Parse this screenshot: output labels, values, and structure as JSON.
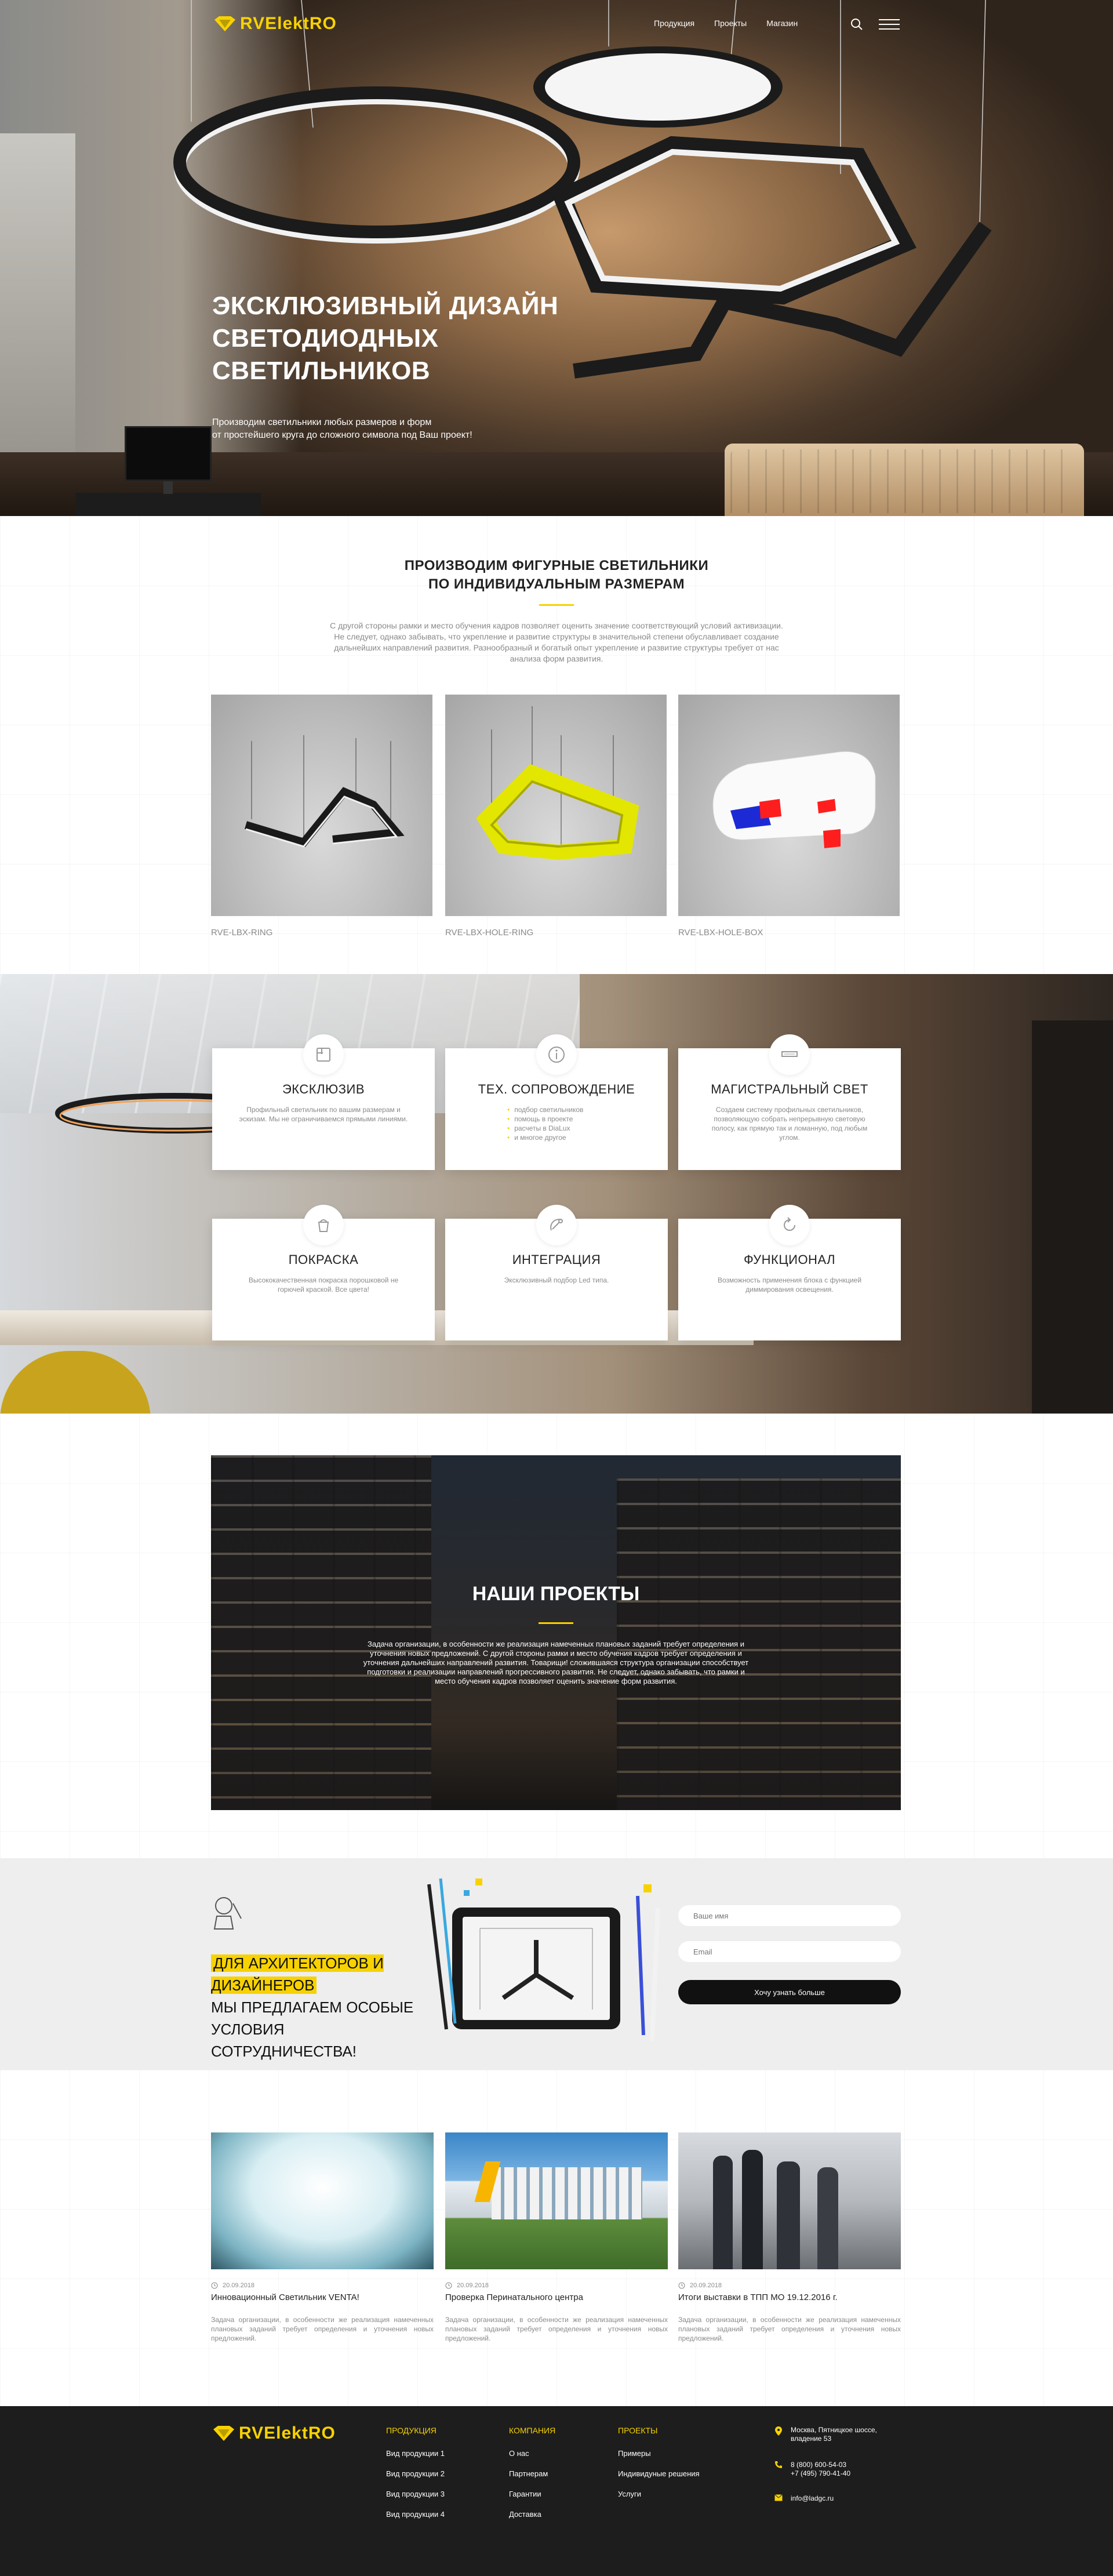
{
  "brand": {
    "logo_text": "RVElektRO",
    "color": "#f7d200"
  },
  "nav": {
    "items": [
      "Продукция",
      "Проекты",
      "Магазин"
    ]
  },
  "hero": {
    "title": "Эксклюзивный дизайн светодиодных светильников",
    "subtitle_line1": "Производим светильники любых размеров и форм",
    "subtitle_line2": "от простейшего круга до сложного символа под Ваш проект!"
  },
  "section1": {
    "title_line1": "Производим фигурные светильники",
    "title_line2": "по индивидуальным размерам",
    "lead": "С другой стороны рамки и место обучения кадров позволяет оценить значение соответствующий условий активизации. Не следует, однако забывать, что укрепление и развитие структуры в значительной степени обуславливает создание дальнейших направлений развития. Разнообразный и богатый опыт укрепление и развитие структуры требует от нас анализа форм развития.",
    "products": [
      {
        "name": "RVE-LBX-RING"
      },
      {
        "name": "RVE-LBX-HOLE-RING"
      },
      {
        "name": "RVE-LBX-HOLE-BOX"
      }
    ]
  },
  "features": [
    {
      "title": "Эксклюзив",
      "icon": "ruler-icon",
      "text": "Профильный светильник по вашим размерам и эскизам. Мы не ограничиваемся прямыми линиями."
    },
    {
      "title": "Тех. сопровождение",
      "icon": "info-icon",
      "list": [
        "подбор светильников",
        "помощь в проекте",
        "расчеты в DiaLux",
        "и многое другое"
      ]
    },
    {
      "title": "Магистральный свет",
      "icon": "track-icon",
      "text": "Создаем систему профильных светильников, позволяющую собрать непрерывную световую полосу, как прямую так и ломанную, под любым углом."
    },
    {
      "title": "Покраска",
      "icon": "paint-bucket-icon",
      "text": "Высококачественная покраска порошковой не горючей краской. Все цвета!"
    },
    {
      "title": "Интеграция",
      "icon": "satellite-icon",
      "text": "Эксклюзивный подбор Led типа."
    },
    {
      "title": "Функционал",
      "icon": "refresh-icon",
      "text": "Возможность применения блока с функцией диммирования освещения."
    }
  ],
  "projects": {
    "title": "Наши проекты",
    "text": "Задача организации, в особенности же реализация намеченных плановых заданий требует определения и уточнения новых предложений. С другой стороны рамки и место обучения кадров требует определения и уточнения дальнейших направлений развития. Товарищи! сложившаяся структура организации способствует подготовки и реализации направлений прогрессивного развития. Не следует, однако забывать, что рамки и место обучения кадров позволяет оценить значение форм развития."
  },
  "cta": {
    "title_highlight": "Для архитекторов и дизайнеров",
    "title_rest_1": "мы предлагаем особые условия",
    "title_rest_2": "сотрудничества!",
    "name_placeholder": "Ваше имя",
    "email_placeholder": "Email",
    "button": "Хочу узнать больше"
  },
  "news": [
    {
      "date": "20.09.2018",
      "title": "Инновационный Светильник VENTA!",
      "text": "Задача организации, в особенности же реализация намеченных плановых заданий требует определения и уточнения новых предложений."
    },
    {
      "date": "20.09.2018",
      "title": "Проверка Перинатального центра",
      "text": "Задача организации, в особенности же реализация намеченных плановых заданий требует определения и уточнения новых предложений."
    },
    {
      "date": "20.09.2018",
      "title": "Итоги выставки в ТПП МО 19.12.2016 г.",
      "text": "Задача организации, в особенности же реализация намеченных плановых заданий требует определения и уточнения новых предложений."
    }
  ],
  "footer": {
    "columns": [
      {
        "title": "Продукция",
        "links": [
          "Вид продукции 1",
          "Вид продукции 2",
          "Вид продукции 3",
          "Вид продукции 4"
        ]
      },
      {
        "title": "Компания",
        "links": [
          "О нас",
          "Партнерам",
          "Гарантии",
          "Доставка"
        ]
      },
      {
        "title": "Проекты",
        "links": [
          "Примеры",
          "Индивидуные решения",
          "Услуги"
        ]
      }
    ],
    "address_line1": "Москва, Пятницкое шоссе,",
    "address_line2": "владение 53",
    "phone1": "8 (800) 600-54-03",
    "phone2": "+7 (495) 790-41-40",
    "email": "info@ladgc.ru"
  }
}
